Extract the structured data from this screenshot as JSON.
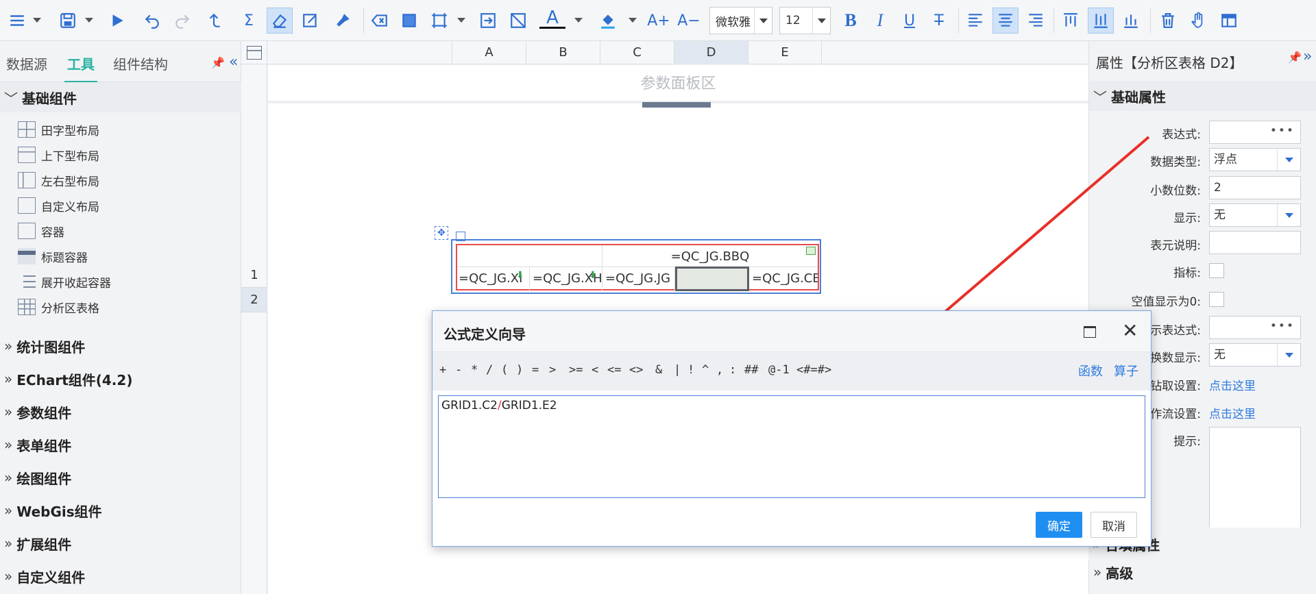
{
  "toolbar": {
    "font_family": "微软雅",
    "font_size": "12",
    "icons": [
      "menu-icon",
      "save-icon",
      "run-icon",
      "undo-icon",
      "redo-icon",
      "upload-icon",
      "sigma-icon",
      "eraser-icon",
      "edit-icon",
      "format-brush-icon",
      "clear-icon",
      "fill-rect-icon",
      "merge-icon",
      "insert-icon",
      "diagonal-icon",
      "font-color-icon",
      "fill-color-icon",
      "font-increase-icon",
      "font-decrease-icon",
      "bold-icon",
      "italic-icon",
      "underline-icon",
      "strikethrough-icon",
      "align-left-icon",
      "align-center-icon",
      "align-right-icon",
      "valign-top-icon",
      "valign-middle-icon",
      "valign-bottom-icon",
      "delete-icon",
      "hand-icon",
      "table-icon"
    ]
  },
  "left_panel": {
    "tabs": [
      "数据源",
      "工具",
      "组件结构"
    ],
    "active_tab": "工具",
    "groups": [
      {
        "label": "基础组件",
        "expanded": true
      },
      {
        "label": "统计图组件"
      },
      {
        "label": "EChart组件(4.2)"
      },
      {
        "label": "参数组件"
      },
      {
        "label": "表单组件"
      },
      {
        "label": "绘图组件"
      },
      {
        "label": "WebGis组件"
      },
      {
        "label": "扩展组件"
      },
      {
        "label": "自定义组件"
      }
    ],
    "basic_items": [
      "田字型布局",
      "上下型布局",
      "左右型布局",
      "自定义布局",
      "容器",
      "标题容器",
      "展开收起容器",
      "分析区表格"
    ]
  },
  "sheet": {
    "columns": [
      "A",
      "B",
      "C",
      "D",
      "E"
    ],
    "rows": [
      "1",
      "2"
    ],
    "param_area": "参数面板区",
    "cells": {
      "title": "=QC_JG.BBQ",
      "a2": "=QC_JG.XI",
      "b2": "=QC_JG.XH",
      "c2": "=QC_JG.JG",
      "d2": "",
      "e2": "=QC_JG.CB"
    }
  },
  "right_panel": {
    "title": "属性【分析区表格 D2】",
    "basic_props": "基础属性",
    "labels": {
      "expr": "表达式:",
      "dtype": "数据类型:",
      "decimals": "小数位数:",
      "display": "显示:",
      "desc": "表元说明:",
      "indicator": "指标:",
      "null_zero": "空值显示为0:",
      "show_expr": "示表达式:",
      "func_display": "换数显示:",
      "drill": "钻取设置:",
      "flow": "作流设置:",
      "hint": "提示:"
    },
    "values": {
      "dtype": "浮点",
      "decimals": "2",
      "display": "无",
      "func_display": "无",
      "drill_link": "点击这里",
      "flow_link": "点击这里"
    },
    "bottom_groups": [
      "合填属性",
      "高级"
    ]
  },
  "dialog": {
    "title": "公式定义向导",
    "operators": [
      "+",
      "-",
      "*",
      "/",
      "(",
      ")",
      "=",
      ">",
      ">=",
      "<",
      "<=",
      "<>",
      "&",
      "|",
      "!",
      "^",
      ",",
      ":",
      "##",
      "@-1",
      "<#=#>"
    ],
    "links": [
      "函数",
      "算子"
    ],
    "formula_left": "GRID1.C2",
    "formula_op": "/",
    "formula_right": "GRID1.E2",
    "ok": "确定",
    "cancel": "取消"
  }
}
